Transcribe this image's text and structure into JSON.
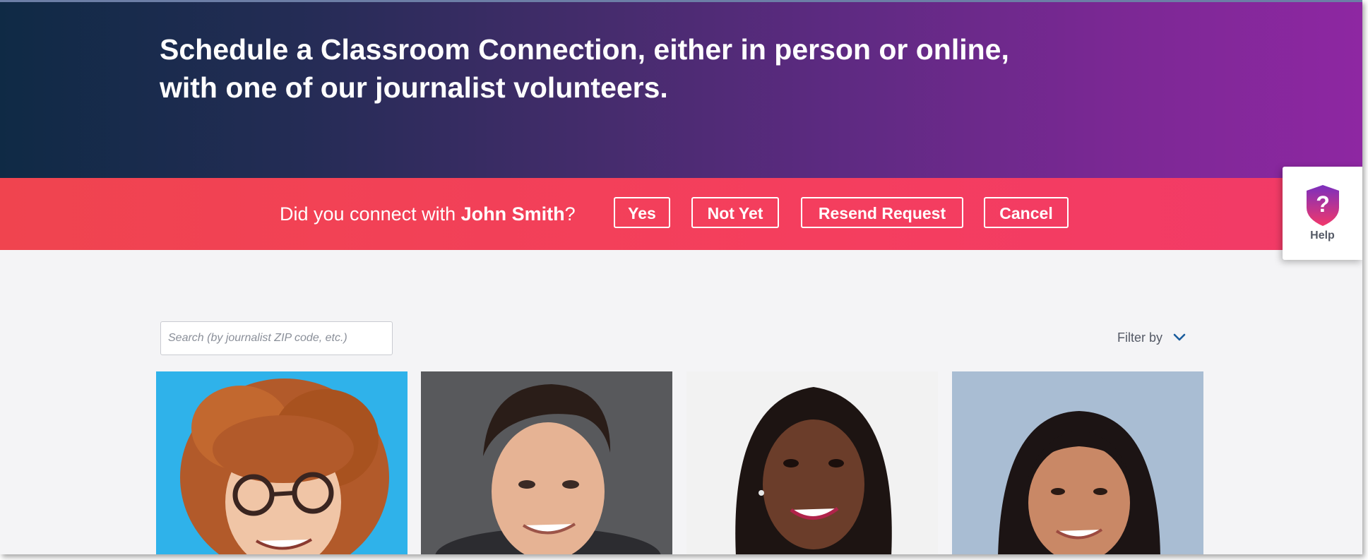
{
  "hero": {
    "title_line1": "Schedule a Classroom Connection, either in person or online,",
    "title_line2": "with one of our journalist volunteers."
  },
  "connect_banner": {
    "question_prefix": "Did you connect with ",
    "journalist_name": "John Smith",
    "question_suffix": "?",
    "buttons": {
      "yes": "Yes",
      "not_yet": "Not Yet",
      "resend": "Resend Request",
      "cancel": "Cancel"
    }
  },
  "help": {
    "label": "Help",
    "icon": "help-shield-icon"
  },
  "search": {
    "value": "",
    "placeholder": "Search (by journalist ZIP code, etc.)"
  },
  "filter": {
    "label": "Filter by",
    "icon": "chevron-down-icon"
  },
  "journalists": [
    {
      "photo": "journalist-photo-1",
      "background": "#2fb2ea"
    },
    {
      "photo": "journalist-photo-2",
      "background": "#58595c"
    },
    {
      "photo": "journalist-photo-3",
      "background": "#f2f2f2"
    },
    {
      "photo": "journalist-photo-4",
      "background": "#a9bdd3"
    }
  ],
  "colors": {
    "banner": "#f4405c",
    "hero_start": "#0f2a45",
    "hero_end": "#8e27a2",
    "accent_blue": "#1a5c9c",
    "help_badge": "#b8329e"
  }
}
